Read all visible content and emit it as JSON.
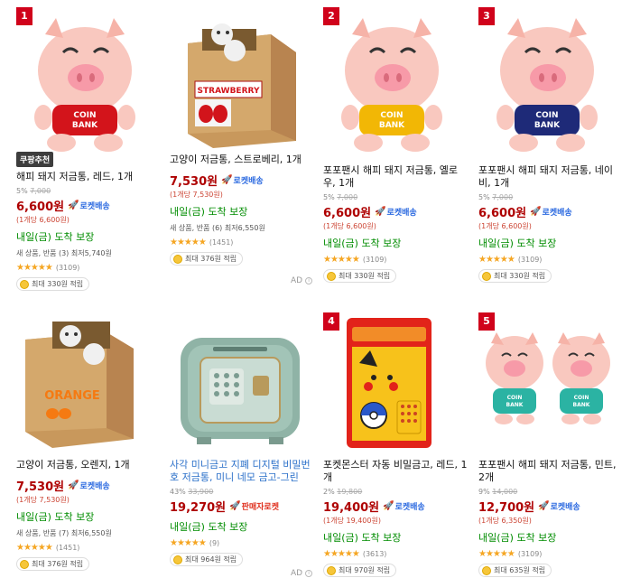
{
  "products": [
    {
      "rank": "1",
      "badge": "쿠팡추천",
      "title": "해피 돼지 저금통, 레드, 1개",
      "discount_pct": "5%",
      "original_price": "7,000",
      "price": "6,600원",
      "delivery_type": "로켓배송",
      "unit_price": "(1개당 6,600원)",
      "arrival": "내일(금) 도착 보장",
      "extra": "새 상품, 반품 (3) 최저5,740원",
      "rating": 4.5,
      "stars": "★★★★★",
      "review_count": "(3109)",
      "points": "최대 330원 적립",
      "image": "pig-red-shirt",
      "shirt_color": "#d3141b"
    },
    {
      "rank": "",
      "badge": "",
      "title": "고양이 저금통, 스트로베리, 1개",
      "discount_pct": "",
      "original_price": "",
      "price": "7,530원",
      "delivery_type": "로켓배송",
      "unit_price": "(1개당 7,530원)",
      "arrival": "내일(금) 도착 보장",
      "extra": "새 상품, 반품 (6) 최저6,550원",
      "rating": 4.5,
      "stars": "★★★★★",
      "review_count": "(1451)",
      "points": "최대 376원 적립",
      "image": "cat-box-strawberry",
      "box_label": "STRAWBERRY"
    },
    {
      "rank": "2",
      "badge": "",
      "title": "포포팬시 해피 돼지 저금통, 옐로우, 1개",
      "discount_pct": "5%",
      "original_price": "7,000",
      "price": "6,600원",
      "delivery_type": "로켓배송",
      "unit_price": "(1개당 6,600원)",
      "arrival": "내일(금) 도착 보장",
      "extra": "",
      "rating": 4.5,
      "stars": "★★★★★",
      "review_count": "(3109)",
      "points": "최대 330원 적립",
      "image": "pig-yellow-shirt",
      "shirt_color": "#f2b705"
    },
    {
      "rank": "3",
      "badge": "",
      "title": "포포팬시 해피 돼지 저금통, 네이비, 1개",
      "discount_pct": "5%",
      "original_price": "7,000",
      "price": "6,600원",
      "delivery_type": "로켓배송",
      "unit_price": "(1개당 6,600원)",
      "arrival": "내일(금) 도착 보장",
      "extra": "",
      "rating": 4.5,
      "stars": "★★★★★",
      "review_count": "(3109)",
      "points": "최대 330원 적립",
      "image": "pig-navy-shirt",
      "shirt_color": "#1e2a78"
    },
    {
      "rank": "",
      "badge": "",
      "title": "고양이 저금통, 오렌지, 1개",
      "discount_pct": "",
      "original_price": "",
      "price": "7,530원",
      "delivery_type": "로켓배송",
      "unit_price": "(1개당 7,530원)",
      "arrival": "내일(금) 도착 보장",
      "extra": "새 상품, 반품 (7) 최저6,550원",
      "rating": 4.5,
      "stars": "★★★★★",
      "review_count": "(1451)",
      "points": "최대 376원 적립",
      "image": "cat-box-orange",
      "box_label": "ORANGE"
    },
    {
      "rank": "",
      "badge": "",
      "title": "사각 미니금고 지폐 디지털 비밀번호 저금통, 미니 네모 금고-그린",
      "discount_pct": "43%",
      "original_price": "33,900",
      "price": "19,270원",
      "delivery_type": "판매자로켓",
      "unit_price": "",
      "arrival": "내일(금) 도착 보장",
      "extra": "",
      "rating": 4.5,
      "stars": "★★★★★",
      "review_count": "(9)",
      "points": "최대 964원 적립",
      "image": "mini-safe-green"
    },
    {
      "rank": "4",
      "badge": "",
      "title": "포켓몬스터 자동 비밀금고, 레드, 1개",
      "discount_pct": "2%",
      "original_price": "19,800",
      "price": "19,400원",
      "delivery_type": "로켓배송",
      "unit_price": "(1개당 19,400원)",
      "arrival": "내일(금) 도착 보장",
      "extra": "",
      "rating": 4.5,
      "stars": "★★★★★",
      "review_count": "(3613)",
      "points": "최대 970원 적립",
      "image": "pokemon-safe-red"
    },
    {
      "rank": "5",
      "badge": "",
      "title": "포포팬시 해피 돼지 저금통, 민트, 2개",
      "discount_pct": "9%",
      "original_price": "14,000",
      "price": "12,700원",
      "delivery_type": "로켓배송",
      "unit_price": "(1개당 6,350원)",
      "arrival": "내일(금) 도착 보장",
      "extra": "",
      "rating": 4.5,
      "stars": "★★★★★",
      "review_count": "(3109)",
      "points": "최대 635원 적립",
      "image": "pig-mint-shirt-x2",
      "shirt_color": "#2bb3a3"
    }
  ],
  "ad_label": "AD",
  "coin_text": "BANK",
  "coin_text2": "COIN"
}
